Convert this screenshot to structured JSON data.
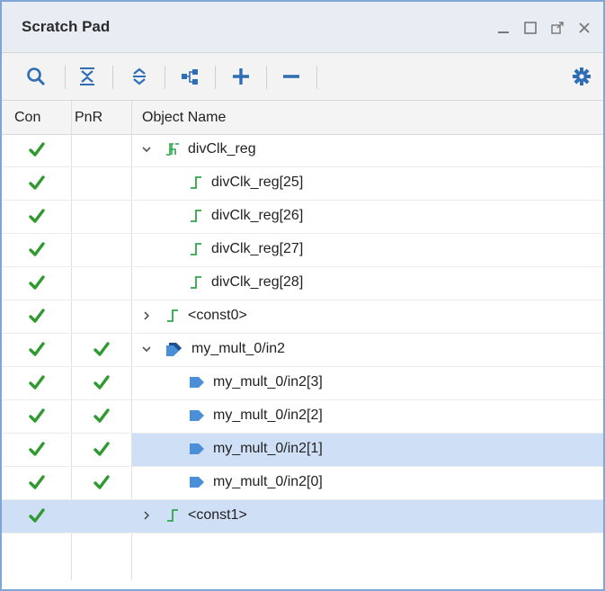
{
  "panel": {
    "title": "Scratch Pad"
  },
  "toolbar": {
    "icons": [
      "search-icon",
      "collapse-all-icon",
      "expand-all-icon",
      "hierarchy-icon",
      "add-icon",
      "remove-icon",
      "settings-icon"
    ]
  },
  "columns": {
    "con": "Con",
    "pnr": "PnR",
    "object": "Object Name"
  },
  "rows": [
    {
      "con": "✔",
      "pnr": "",
      "name": "divClk_reg",
      "indent": 1,
      "expander": "expanded",
      "icon": "bus-green-icon"
    },
    {
      "con": "✔",
      "pnr": "",
      "name": "divClk_reg[25]",
      "indent": 2,
      "expander": "",
      "icon": "net-green-icon"
    },
    {
      "con": "✔",
      "pnr": "",
      "name": "divClk_reg[26]",
      "indent": 2,
      "expander": "",
      "icon": "net-green-icon"
    },
    {
      "con": "✔",
      "pnr": "",
      "name": "divClk_reg[27]",
      "indent": 2,
      "expander": "",
      "icon": "net-green-icon"
    },
    {
      "con": "✔",
      "pnr": "",
      "name": "divClk_reg[28]",
      "indent": 2,
      "expander": "",
      "icon": "net-green-icon"
    },
    {
      "con": "✔",
      "pnr": "",
      "name": "<const0>",
      "indent": 1,
      "expander": "collapsed",
      "icon": "net-green-icon"
    },
    {
      "con": "✔",
      "pnr": "✔",
      "name": "my_mult_0/in2",
      "indent": 1,
      "expander": "expanded",
      "icon": "port-bus-icon"
    },
    {
      "con": "✔",
      "pnr": "✔",
      "name": "my_mult_0/in2[3]",
      "indent": 2,
      "expander": "",
      "icon": "port-icon"
    },
    {
      "con": "✔",
      "pnr": "✔",
      "name": "my_mult_0/in2[2]",
      "indent": 2,
      "expander": "",
      "icon": "port-icon"
    },
    {
      "con": "✔",
      "pnr": "✔",
      "name": "my_mult_0/in2[1]",
      "indent": 2,
      "expander": "",
      "icon": "port-icon",
      "selected": "name"
    },
    {
      "con": "✔",
      "pnr": "✔",
      "name": "my_mult_0/in2[0]",
      "indent": 2,
      "expander": "",
      "icon": "port-icon"
    },
    {
      "con": "✔",
      "pnr": "",
      "name": "<const1>",
      "indent": 1,
      "expander": "collapsed",
      "icon": "net-green-icon",
      "selected": "row"
    }
  ],
  "colors": {
    "check": "#2f9a2f",
    "net": "#2da64a",
    "port": "#4a8fd8",
    "selection": "#cfdff6",
    "accent": "#2f6db5"
  }
}
